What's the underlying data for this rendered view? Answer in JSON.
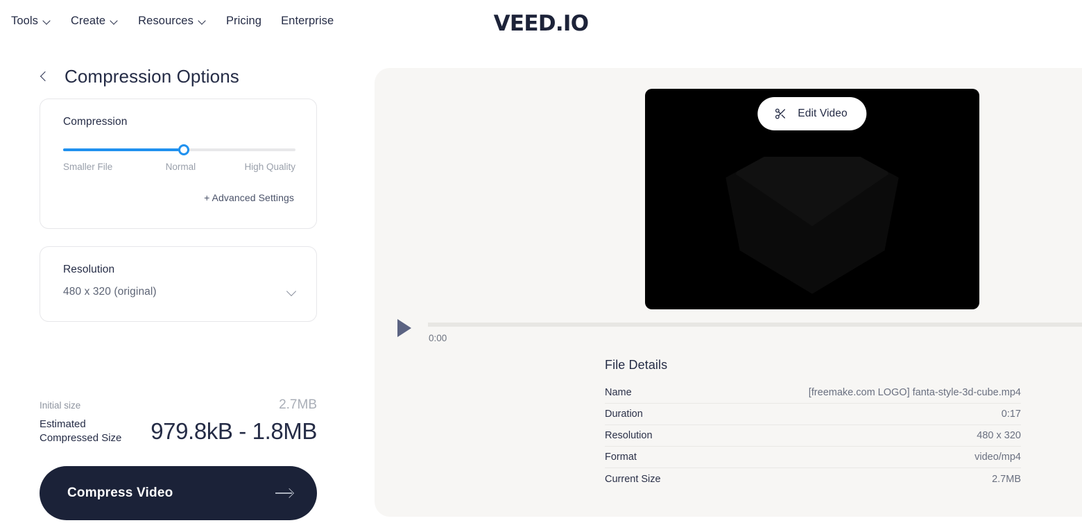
{
  "nav": {
    "items": [
      {
        "label": "Tools",
        "has_caret": true
      },
      {
        "label": "Create",
        "has_caret": true
      },
      {
        "label": "Resources",
        "has_caret": true
      },
      {
        "label": "Pricing",
        "has_caret": false
      },
      {
        "label": "Enterprise",
        "has_caret": false
      }
    ],
    "brand": "VEED.IO"
  },
  "sidebar": {
    "title": "Compression Options",
    "compression_card": {
      "label": "Compression",
      "slider": {
        "value_percent": 52,
        "min_label": "Smaller File",
        "mid_label": "Normal",
        "max_label": "High Quality",
        "accent_color": "#2091ef"
      },
      "advanced_link": "+ Advanced Settings"
    },
    "resolution_card": {
      "label": "Resolution",
      "selected": "480 x 320 (original)"
    },
    "initial_size": {
      "label": "Initial size",
      "value": "2.7MB"
    },
    "estimated_size": {
      "label": "Estimated Compressed Size",
      "value": "979.8kB - 1.8MB"
    },
    "compress_button": {
      "label": "Compress Video",
      "color": "#1b2238"
    }
  },
  "preview": {
    "edit_button": "Edit Video",
    "player": {
      "current_time": "0:00",
      "progress_percent": 0
    },
    "file_details": {
      "title": "File Details",
      "rows": [
        {
          "key": "Name",
          "value": "[freemake.com LOGO] fanta-style-3d-cube.mp4"
        },
        {
          "key": "Duration",
          "value": "0:17"
        },
        {
          "key": "Resolution",
          "value": "480 x 320"
        },
        {
          "key": "Format",
          "value": "video/mp4"
        },
        {
          "key": "Current Size",
          "value": "2.7MB"
        }
      ]
    }
  }
}
